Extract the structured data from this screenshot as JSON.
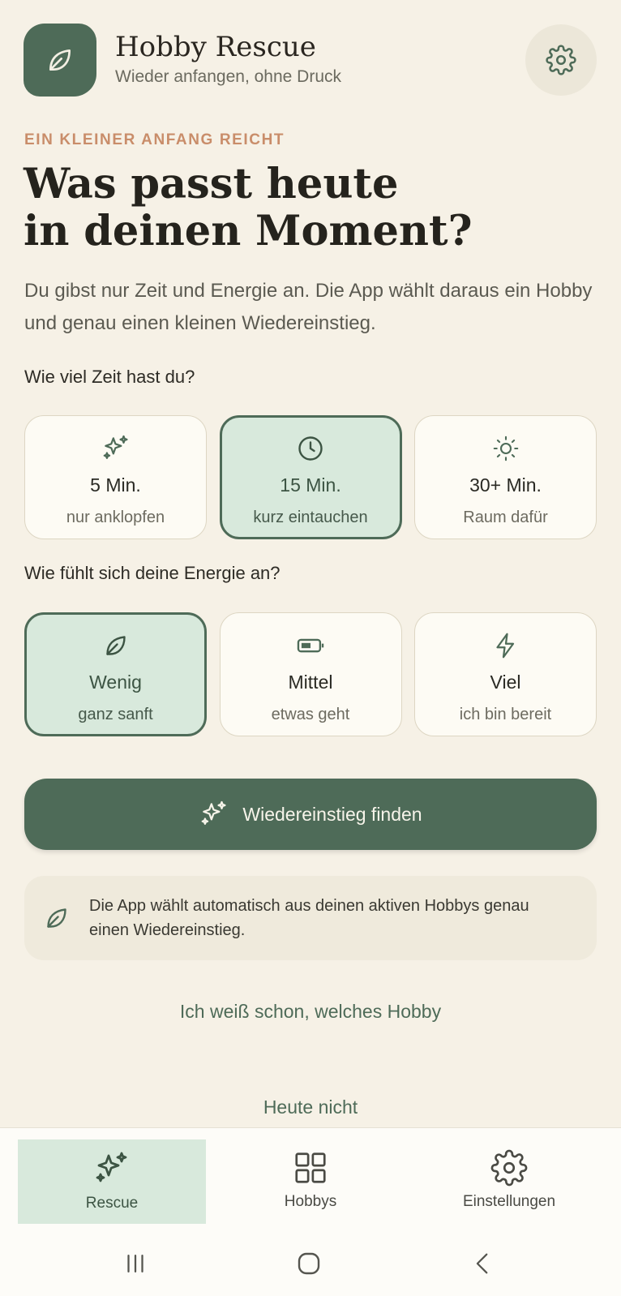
{
  "header": {
    "title": "Hobby Rescue",
    "subtitle": "Wieder anfangen, ohne Druck",
    "logo_icon": "leaf-icon",
    "settings_icon": "gear-icon"
  },
  "eyebrow": "EIN KLEINER ANFANG REICHT",
  "headline": {
    "line1": "Was passt heute",
    "line2": "in deinen Moment?"
  },
  "intro": "Du gibst nur Zeit und Energie an. Die App wählt daraus ein Hobby und genau einen kleinen Wiedereinstieg.",
  "time": {
    "label": "Wie viel Zeit hast du?",
    "options": [
      {
        "icon": "sparkles-icon",
        "title": "5 Min.",
        "sub": "nur anklopfen",
        "selected": false
      },
      {
        "icon": "clock-icon",
        "title": "15 Min.",
        "sub": "kurz eintauchen",
        "selected": true
      },
      {
        "icon": "sun-icon",
        "title": "30+ Min.",
        "sub": "Raum dafür",
        "selected": false
      }
    ]
  },
  "energy": {
    "label": "Wie fühlt sich deine Energie an?",
    "options": [
      {
        "icon": "leaf-icon",
        "title": "Wenig",
        "sub": "ganz sanft",
        "selected": true
      },
      {
        "icon": "battery-icon",
        "title": "Mittel",
        "sub": "etwas geht",
        "selected": false
      },
      {
        "icon": "bolt-icon",
        "title": "Viel",
        "sub": "ich bin bereit",
        "selected": false
      }
    ]
  },
  "cta": {
    "label": "Wiedereinstieg finden",
    "icon": "sparkles-icon"
  },
  "info": {
    "icon": "leaf-icon",
    "text": "Die App wählt automatisch aus deinen aktiven Hobbys genau einen Wiedereinstieg."
  },
  "links": {
    "choose_hobby": "Ich weiß schon, welches Hobby",
    "not_today": "Heute nicht"
  },
  "bottom_nav": [
    {
      "icon": "sparkles-icon",
      "label": "Rescue",
      "active": true
    },
    {
      "icon": "grid-icon",
      "label": "Hobbys",
      "active": false
    },
    {
      "icon": "gear-icon",
      "label": "Einstellungen",
      "active": false
    }
  ],
  "colors": {
    "background": "#f6f1e6",
    "primary": "#4e6b58",
    "selected_fill": "#d8e9dc",
    "accent": "#c98d6a"
  }
}
